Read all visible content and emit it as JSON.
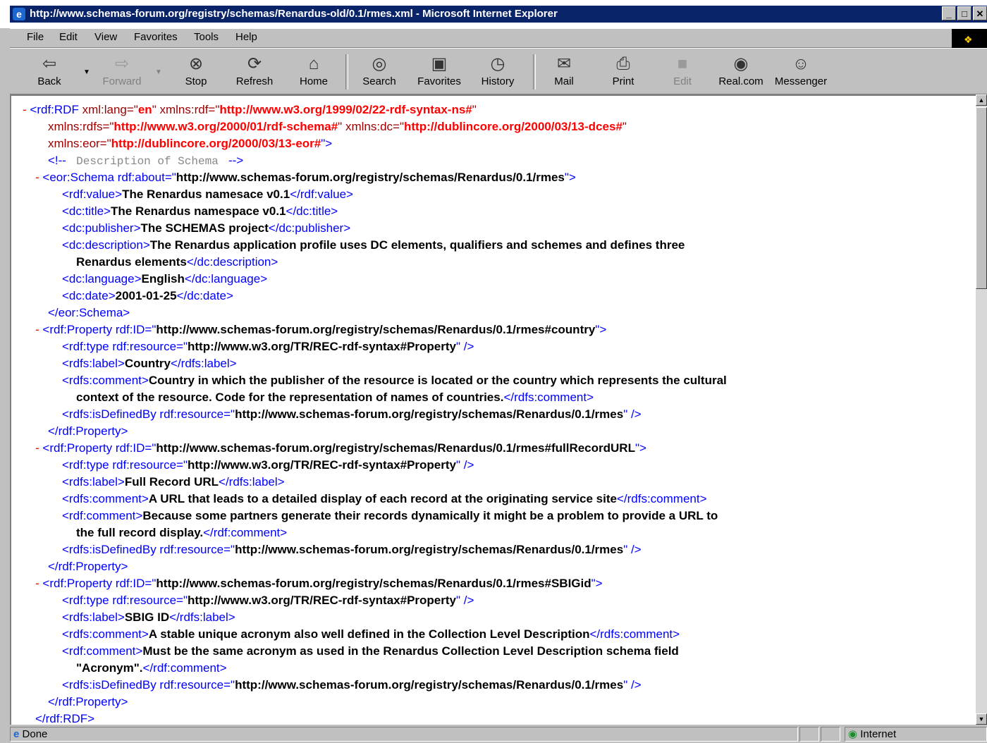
{
  "window": {
    "title": "http://www.schemas-forum.org/registry/schemas/Renardus-old/0.1/rmes.xml - Microsoft Internet Explorer",
    "buttons": [
      "_",
      "□",
      "✕"
    ]
  },
  "menu": {
    "file": "File",
    "edit": "Edit",
    "view": "View",
    "favorites": "Favorites",
    "tools": "Tools",
    "help": "Help"
  },
  "toolbar": {
    "back": "Back",
    "forward": "Forward",
    "stop": "Stop",
    "refresh": "Refresh",
    "home": "Home",
    "search": "Search",
    "favorites": "Favorites",
    "history": "History",
    "mail": "Mail",
    "print": "Print",
    "edit": "Edit",
    "realcom": "Real.com",
    "messenger": "Messenger"
  },
  "xml": {
    "minus": "-",
    "rdf_open": "<rdf:RDF",
    "lang_attr": "xml:lang=\"",
    "lang_val": "en",
    "q": "\"",
    "xmlns_rdf": "xmlns:rdf=\"",
    "xmlns_rdf_val": "http://www.w3.org/1999/02/22-rdf-syntax-ns#",
    "xmlns_rdfs": "xmlns:rdfs=\"",
    "xmlns_rdfs_val": "http://www.w3.org/2000/01/rdf-schema#",
    "xmlns_dc": "xmlns:dc=\"",
    "xmlns_dc_val": "http://dublincore.org/2000/03/13-dces#",
    "xmlns_eor": "xmlns:eor=\"",
    "xmlns_eor_val": "http://dublincore.org/2000/03/13-eor#",
    "close_gt": "\">",
    "comment_open": "<!--",
    "comment_text": "Description of Schema",
    "comment_close": "-->",
    "schema_open": "<eor:Schema rdf:about=\"",
    "schema_about": "http://www.schemas-forum.org/registry/schemas/Renardus/0.1/rmes",
    "rdf_value_o": "<rdf:value>",
    "rdf_value_t": "The Renardus namesace v0.1",
    "rdf_value_c": "</rdf:value>",
    "dc_title_o": "<dc:title>",
    "dc_title_t": "The Renardus namespace v0.1",
    "dc_title_c": "</dc:title>",
    "dc_pub_o": "<dc:publisher>",
    "dc_pub_t": "The SCHEMAS project",
    "dc_pub_c": "</dc:publisher>",
    "dc_desc_o": "<dc:description>",
    "dc_desc_t1": "The Renardus application profile uses DC elements, qualifiers and schemes and defines three",
    "dc_desc_t2": "Renardus elements",
    "dc_desc_c": "</dc:description>",
    "dc_lang_o": "<dc:language>",
    "dc_lang_t": "English",
    "dc_lang_c": "</dc:language>",
    "dc_date_o": "<dc:date>",
    "dc_date_t": "2001-01-25",
    "dc_date_c": "</dc:date>",
    "schema_close": "</eor:Schema>",
    "prop_open": "<rdf:Property rdf:ID=\"",
    "prop1_id": "http://www.schemas-forum.org/registry/schemas/Renardus/0.1/rmes#country",
    "prop2_id": "http://www.schemas-forum.org/registry/schemas/Renardus/0.1/rmes#fullRecordURL",
    "prop3_id": "http://www.schemas-forum.org/registry/schemas/Renardus/0.1/rmes#SBIGid",
    "type_open": "<rdf:type rdf:resource=\"",
    "type_val": "http://www.w3.org/TR/REC-rdf-syntax#Property",
    "self_close": "\" />",
    "label_o": "<rdfs:label>",
    "label_c": "</rdfs:label>",
    "label1": "Country",
    "label2": "Full Record URL",
    "label3": "SBIG ID",
    "rdfs_comment_o": "<rdfs:comment>",
    "rdfs_comment_c": "</rdfs:comment>",
    "rdf_comment_o": "<rdf:comment>",
    "rdf_comment_c": "</rdf:comment>",
    "c1_t1": "Country in which the publisher of the resource is located or the country which represents the cultural",
    "c1_t2": "context of the resource. Code for the representation of names of countries.",
    "c2_t": "A URL that leads to a detailed display of each record at the originating service site",
    "c2b_t1": "Because some partners generate their records dynamically it might be a problem to provide a URL to",
    "c2b_t2": "the full record display.",
    "c3_t": "A stable unique acronym also well defined in the Collection Level Description",
    "c3b_t1": "Must be the same acronym as used in the Renardus Collection Level Description schema field",
    "c3b_t2": "\"Acronym\".",
    "defby_open": "<rdfs:isDefinedBy rdf:resource=\"",
    "defby_val": "http://www.schemas-forum.org/registry/schemas/Renardus/0.1/rmes",
    "prop_close": "</rdf:Property>",
    "rdf_close": "</rdf:RDF>"
  },
  "status": {
    "text": "Done",
    "zone": "Internet"
  }
}
